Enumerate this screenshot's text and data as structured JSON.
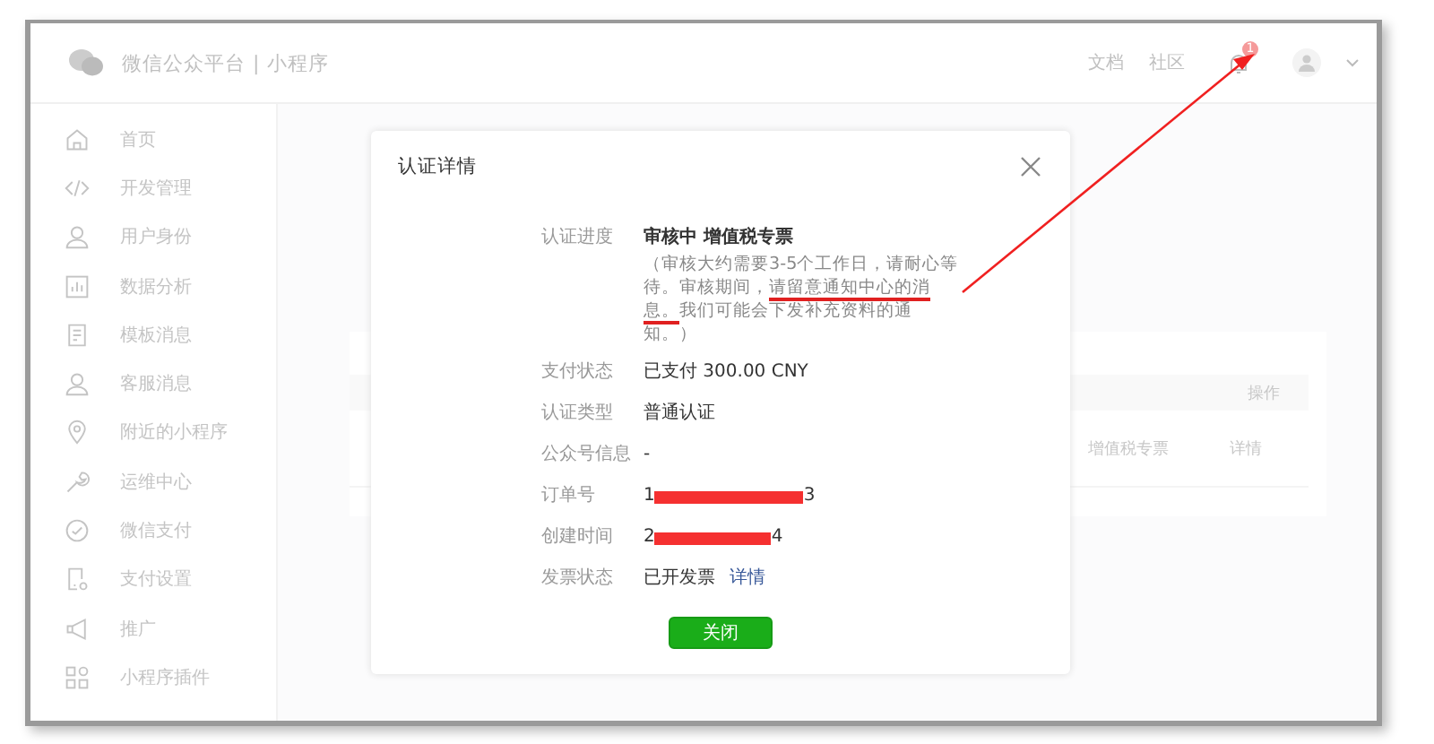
{
  "header": {
    "brand": "微信公众平台 | 小程序",
    "links": [
      "文档",
      "社区"
    ],
    "notification_badge": "1"
  },
  "sidebar": {
    "items": [
      {
        "kind": "home",
        "label": "首页"
      },
      {
        "kind": "code",
        "label": "开发管理"
      },
      {
        "kind": "user",
        "label": "用户身份"
      },
      {
        "kind": "chart",
        "label": "数据分析"
      },
      {
        "kind": "doc",
        "label": "模板消息"
      },
      {
        "kind": "user",
        "label": "客服消息"
      },
      {
        "kind": "pin",
        "label": "附近的小程序"
      },
      {
        "kind": "wrench",
        "label": "运维中心"
      },
      {
        "kind": "check",
        "label": "微信支付"
      },
      {
        "kind": "phone",
        "label": "支付设置"
      },
      {
        "kind": "megaphone",
        "label": "推广"
      },
      {
        "kind": "grid",
        "label": "小程序插件"
      }
    ]
  },
  "background_table": {
    "header": "操作",
    "row": {
      "type": "增值税专票",
      "action": "详情"
    }
  },
  "dialog": {
    "title": "认证详情",
    "rows": [
      {
        "kind": "status",
        "label": "认证进度",
        "value": "审核中 增值税专票",
        "note_before": "（审核大约需要3-5个工作日，请耐心等待。审核期间，",
        "note_underlined": "请留意通知中心的消息。",
        "note_after": "我们可能会下发补充资料的通知。）"
      },
      {
        "kind": "text",
        "label": "支付状态",
        "value": "已支付 300.00 CNY"
      },
      {
        "kind": "text",
        "label": "认证类型",
        "value": "普通认证"
      },
      {
        "kind": "text",
        "label": "公众号信息",
        "value": "-"
      },
      {
        "kind": "redacted",
        "label": "订单号",
        "value_start": "1",
        "value_end": "3"
      },
      {
        "kind": "redacted",
        "label": "创建时间",
        "value_start": "2",
        "value_end": "4"
      },
      {
        "kind": "link",
        "label": "发票状态",
        "value": "已开发票",
        "link": "详情"
      }
    ],
    "button": "关闭"
  }
}
